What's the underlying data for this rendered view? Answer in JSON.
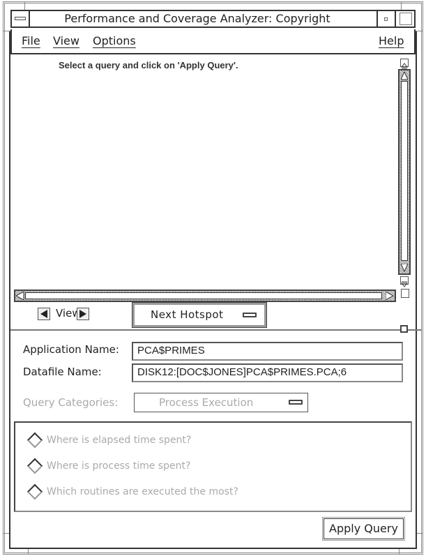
{
  "window": {
    "title": "Performance and Coverage Analyzer: Copyright"
  },
  "menubar": {
    "items": [
      {
        "label": "File"
      },
      {
        "label": "View"
      },
      {
        "label": "Options"
      },
      {
        "label": "Help"
      }
    ]
  },
  "content": {
    "message": "Select a query and click on 'Apply Query'."
  },
  "navigation": {
    "view_label": "View",
    "hotspot_option": "Next Hotspot"
  },
  "form": {
    "application_name_label": "Application Name:",
    "application_name_value": "PCA$PRIMES",
    "datafile_name_label": "Datafile Name:",
    "datafile_name_value": "DISK12:[DOC$JONES]PCA$PRIMES.PCA;6",
    "query_categories_label": "Query Categories:",
    "query_categories_value": "Process Execution"
  },
  "queries": [
    {
      "label": "Where is elapsed time spent?"
    },
    {
      "label": "Where is process time spent?"
    },
    {
      "label": "Which routines are executed the most?"
    }
  ],
  "actions": {
    "apply_query_label": "Apply Query"
  }
}
